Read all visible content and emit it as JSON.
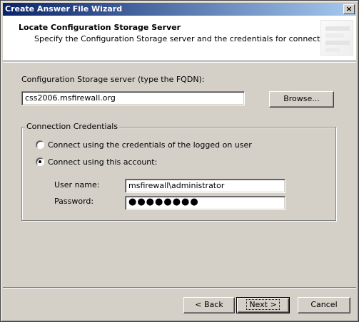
{
  "window": {
    "title": "Create Answer File Wizard",
    "close_glyph": "×"
  },
  "header": {
    "title": "Locate Configuration Storage Server",
    "subtitle": "Specify the Configuration Storage server and the credentials for connecting to it."
  },
  "server": {
    "label": "Configuration Storage server (type the FQDN):",
    "value": "css2006.msfirewall.org",
    "browse_label": "Browse..."
  },
  "credentials": {
    "group_title": "Connection Credentials",
    "option_logged_on": "Connect using the credentials of the logged on user",
    "option_account": "Connect using this account:",
    "selected": "option_account",
    "username_label": "User name:",
    "username_value": "msfirewall\\administrator",
    "password_label": "Password:",
    "password_value": "●●●●●●●●"
  },
  "footer": {
    "back_label": "< Back",
    "next_label": "Next >",
    "cancel_label": "Cancel"
  },
  "colors": {
    "dialog_bg": "#d4d0c8",
    "title_gradient_start": "#0a246a",
    "title_gradient_end": "#a6caf0"
  }
}
